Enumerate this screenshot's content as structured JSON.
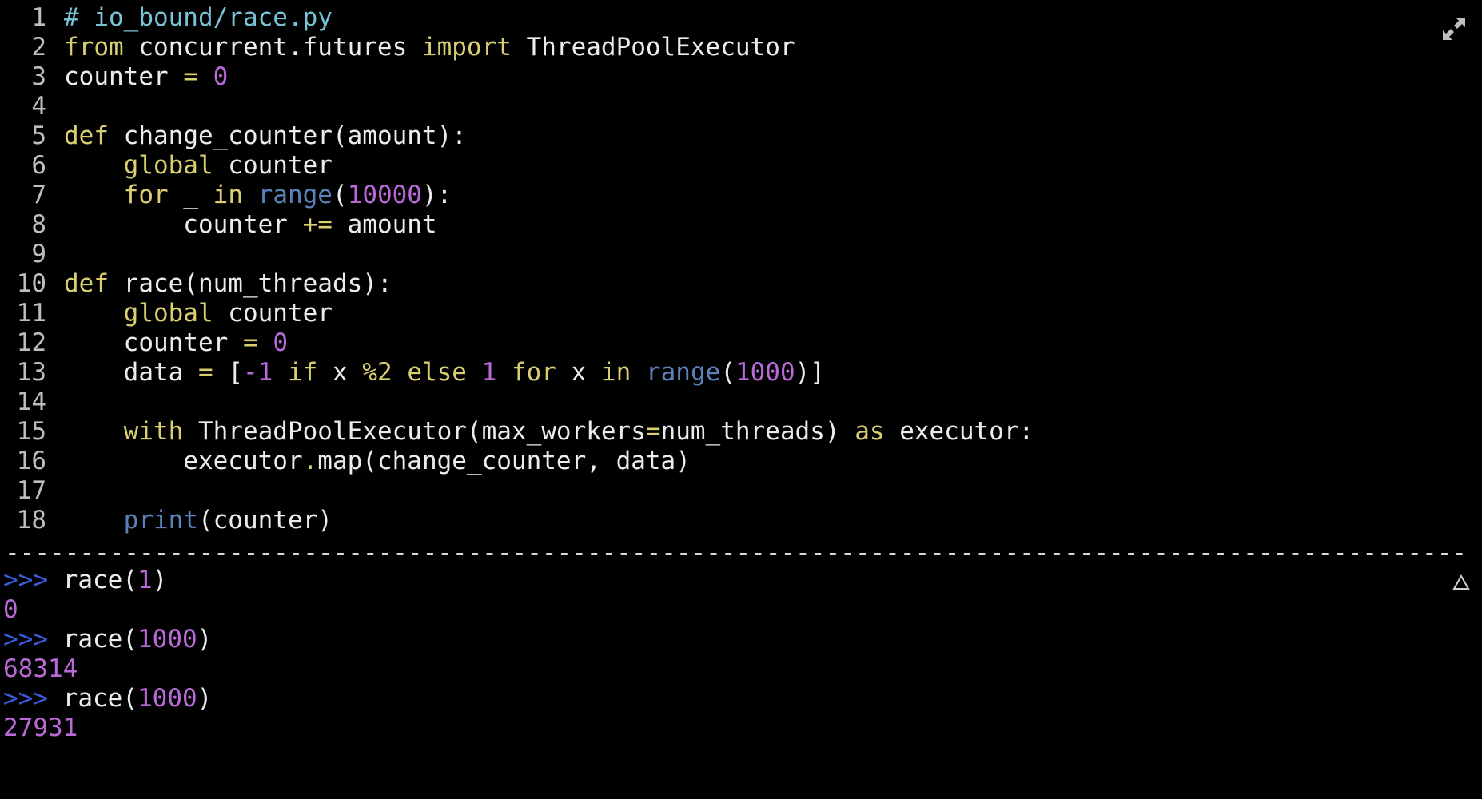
{
  "editor": {
    "lines": [
      {
        "num": "1",
        "tokens": [
          {
            "t": "# io_bound/race.py",
            "c": "comment"
          }
        ]
      },
      {
        "num": "2",
        "tokens": [
          {
            "t": "from",
            "c": "keyword"
          },
          {
            "t": " concurrent.futures ",
            "c": "text"
          },
          {
            "t": "import",
            "c": "keyword"
          },
          {
            "t": " ThreadPoolExecutor",
            "c": "text"
          }
        ]
      },
      {
        "num": "3",
        "tokens": [
          {
            "t": "counter ",
            "c": "text"
          },
          {
            "t": "=",
            "c": "keyword"
          },
          {
            "t": " ",
            "c": "text"
          },
          {
            "t": "0",
            "c": "number"
          }
        ]
      },
      {
        "num": "4",
        "tokens": []
      },
      {
        "num": "5",
        "tokens": [
          {
            "t": "def",
            "c": "keyword"
          },
          {
            "t": " change_counter(amount):",
            "c": "text"
          }
        ]
      },
      {
        "num": "6",
        "tokens": [
          {
            "t": "    ",
            "c": "text"
          },
          {
            "t": "global",
            "c": "keyword"
          },
          {
            "t": " counter",
            "c": "text"
          }
        ]
      },
      {
        "num": "7",
        "tokens": [
          {
            "t": "    ",
            "c": "text"
          },
          {
            "t": "for",
            "c": "keyword"
          },
          {
            "t": " _ ",
            "c": "text"
          },
          {
            "t": "in",
            "c": "keyword"
          },
          {
            "t": " ",
            "c": "text"
          },
          {
            "t": "range",
            "c": "builtin"
          },
          {
            "t": "(",
            "c": "text"
          },
          {
            "t": "10000",
            "c": "number"
          },
          {
            "t": "):",
            "c": "text"
          }
        ]
      },
      {
        "num": "8",
        "tokens": [
          {
            "t": "        counter ",
            "c": "text"
          },
          {
            "t": "+=",
            "c": "keyword"
          },
          {
            "t": " amount",
            "c": "text"
          }
        ]
      },
      {
        "num": "9",
        "tokens": []
      },
      {
        "num": "10",
        "tokens": [
          {
            "t": "def",
            "c": "keyword"
          },
          {
            "t": " race(num_threads):",
            "c": "text"
          }
        ]
      },
      {
        "num": "11",
        "tokens": [
          {
            "t": "    ",
            "c": "text"
          },
          {
            "t": "global",
            "c": "keyword"
          },
          {
            "t": " counter",
            "c": "text"
          }
        ]
      },
      {
        "num": "12",
        "tokens": [
          {
            "t": "    counter ",
            "c": "text"
          },
          {
            "t": "=",
            "c": "keyword"
          },
          {
            "t": " ",
            "c": "text"
          },
          {
            "t": "0",
            "c": "number"
          }
        ]
      },
      {
        "num": "13",
        "tokens": [
          {
            "t": "    data ",
            "c": "text"
          },
          {
            "t": "=",
            "c": "keyword"
          },
          {
            "t": " [",
            "c": "text"
          },
          {
            "t": "-1",
            "c": "number"
          },
          {
            "t": " ",
            "c": "text"
          },
          {
            "t": "if",
            "c": "keyword"
          },
          {
            "t": " x ",
            "c": "text"
          },
          {
            "t": "%2",
            "c": "keyword"
          },
          {
            "t": " ",
            "c": "text"
          },
          {
            "t": "else",
            "c": "keyword"
          },
          {
            "t": " ",
            "c": "text"
          },
          {
            "t": "1",
            "c": "number"
          },
          {
            "t": " ",
            "c": "text"
          },
          {
            "t": "for",
            "c": "keyword"
          },
          {
            "t": " x ",
            "c": "text"
          },
          {
            "t": "in",
            "c": "keyword"
          },
          {
            "t": " ",
            "c": "text"
          },
          {
            "t": "range",
            "c": "builtin"
          },
          {
            "t": "(",
            "c": "text"
          },
          {
            "t": "1000",
            "c": "number"
          },
          {
            "t": ")]",
            "c": "text"
          }
        ]
      },
      {
        "num": "14",
        "tokens": []
      },
      {
        "num": "15",
        "tokens": [
          {
            "t": "    ",
            "c": "text"
          },
          {
            "t": "with",
            "c": "keyword"
          },
          {
            "t": " ThreadPoolExecutor(max_workers",
            "c": "text"
          },
          {
            "t": "=",
            "c": "keyword"
          },
          {
            "t": "num_threads) ",
            "c": "text"
          },
          {
            "t": "as",
            "c": "keyword"
          },
          {
            "t": " executor:",
            "c": "text"
          }
        ]
      },
      {
        "num": "16",
        "tokens": [
          {
            "t": "        executor",
            "c": "text"
          },
          {
            "t": ".",
            "c": "keyword"
          },
          {
            "t": "map(change_counter, data)",
            "c": "text"
          }
        ]
      },
      {
        "num": "17",
        "tokens": []
      },
      {
        "num": "18",
        "tokens": [
          {
            "t": "    ",
            "c": "text"
          },
          {
            "t": "print",
            "c": "builtin"
          },
          {
            "t": "(counter)",
            "c": "text"
          }
        ]
      }
    ]
  },
  "divider": "-------------------------------------------------------------------------------------------------------------------",
  "repl": {
    "entries": [
      {
        "prompt": ">>>",
        "command": "race",
        "arg": "1",
        "output": "0"
      },
      {
        "prompt": ">>>",
        "command": "race",
        "arg": "1000",
        "output": "68314"
      },
      {
        "prompt": ">>>",
        "command": "race",
        "arg": "1000",
        "output": "27931"
      }
    ]
  },
  "icons": {
    "expand": "expand-icon",
    "scroll_up": "triangle-up-icon"
  },
  "colors": {
    "background": "#000000",
    "text": "#ececec",
    "keyword": "#d9cf71",
    "number": "#b96ad8",
    "builtin": "#5a82b8",
    "comment": "#79c3d6",
    "line_number": "#bdbdbd",
    "prompt": "#3b5bdb"
  }
}
